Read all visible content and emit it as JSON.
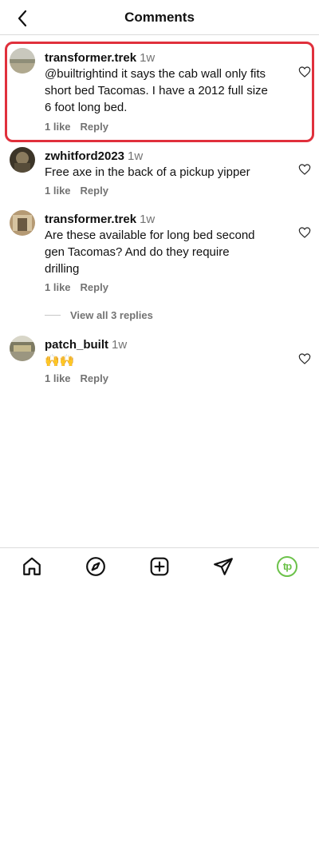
{
  "header": {
    "title": "Comments"
  },
  "comments": [
    {
      "username": "transformer.trek",
      "time": "1w",
      "text": "@builtrightind it says the cab wall only fits short bed Tacomas. I have a 2012 full size 6 foot long bed.",
      "likes": "1 like",
      "reply_label": "Reply"
    },
    {
      "username": "zwhitford2023",
      "time": "1w",
      "text": "Free axe in the back of a pickup yipper",
      "likes": "1 like",
      "reply_label": "Reply"
    },
    {
      "username": "transformer.trek",
      "time": "1w",
      "text": "Are these available for long bed second gen Tacomas? And do they require drilling",
      "likes": "1 like",
      "reply_label": "Reply"
    },
    {
      "username": "patch_built",
      "time": "1w",
      "text": "🙌🙌",
      "likes": "1 like",
      "reply_label": "Reply"
    }
  ],
  "view_replies": "View all 3 replies",
  "tabbar": {
    "icons": [
      "home-icon",
      "explore-icon",
      "create-icon",
      "direct-message-icon",
      "profile-icon"
    ],
    "profile_initials": "tp",
    "accent": "#6cc24a"
  },
  "highlight_color": "#e0303c"
}
